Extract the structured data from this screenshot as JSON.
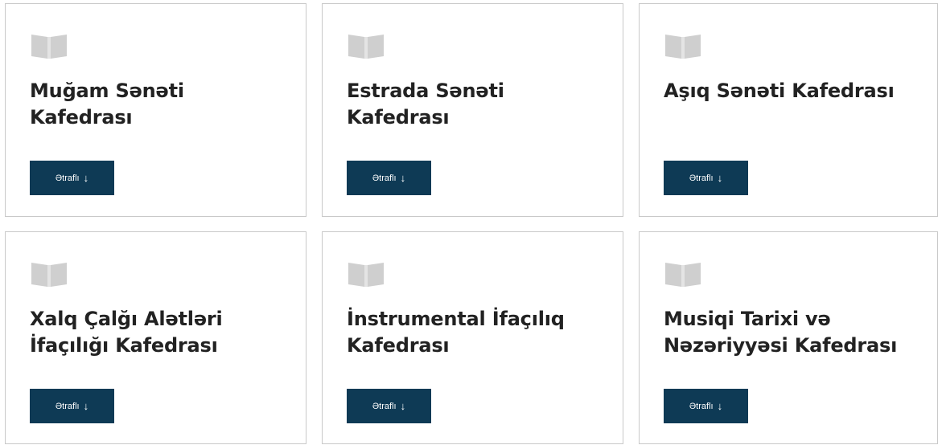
{
  "cards": [
    {
      "title_line1": "Muğam Sənəti",
      "title_line2": "Kafedrası",
      "button_label": "Ətraflı",
      "icon": "open-book-icon"
    },
    {
      "title_line1": "Estrada Sənəti",
      "title_line2": "Kafedrası",
      "button_label": "Ətraflı",
      "icon": "open-book-icon"
    },
    {
      "title_line1": "Aşıq Sənəti Kafedrası",
      "title_line2": "",
      "button_label": "Ətraflı",
      "icon": "open-book-icon"
    },
    {
      "title_line1": "Xalq Çalğı Alətləri",
      "title_line2": "İfaçılığı Kafedrası",
      "button_label": "Ətraflı",
      "icon": "open-book-icon"
    },
    {
      "title_line1": "İnstrumental İfaçılıq",
      "title_line2": "Kafedrası",
      "button_label": "Ətraflı",
      "icon": "open-book-icon"
    },
    {
      "title_line1": "Musiqi Tarixi və",
      "title_line2": "Nəzəriyyəsi Kafedrası",
      "button_label": "Ətraflı",
      "icon": "open-book-icon"
    }
  ],
  "colors": {
    "button_bg": "#0e3a55",
    "icon": "#cfcfcf",
    "border": "#c9c9c9"
  }
}
